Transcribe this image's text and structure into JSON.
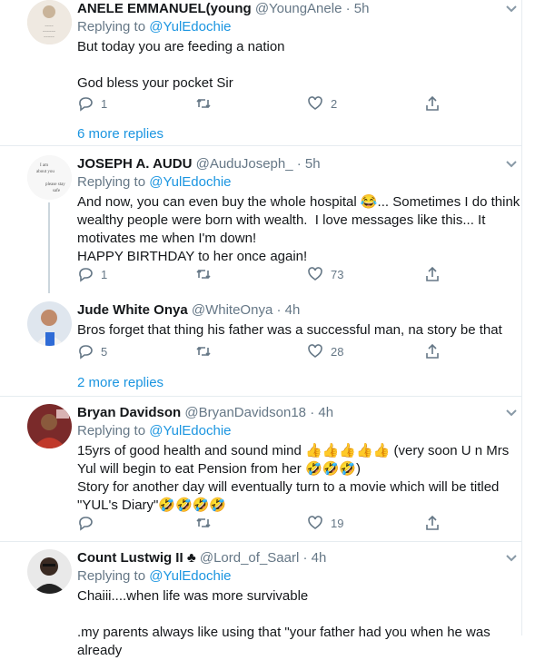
{
  "tweets": [
    {
      "name": "ANELE EMMANUEL(young",
      "handle": "@YoungAnele",
      "time": "· 5h",
      "replying_prefix": "Replying to",
      "replying_to": "@YulEdochie",
      "text": "But today you are feeding a nation\n\nGod bless your pocket Sir",
      "replies": "1",
      "retweets": "",
      "likes": "2",
      "more_replies": "6 more replies"
    },
    {
      "name": "JOSEPH A. AUDU",
      "handle": "@AuduJoseph_",
      "time": "· 5h",
      "replying_prefix": "Replying to",
      "replying_to": "@YulEdochie",
      "text": "And now, you can even buy the whole hospital 😂... Sometimes I do think wealthy people were born with wealth.  I love messages like this... It motivates me when I'm down!\nHAPPY BIRTHDAY to her once again!",
      "replies": "1",
      "retweets": "",
      "likes": "73",
      "more_replies": ""
    },
    {
      "name": "Jude White Onya",
      "handle": "@WhiteOnya",
      "time": "· 4h",
      "replying_prefix": "",
      "replying_to": "",
      "text": "Bros forget that thing his father was a successful man, na story be that",
      "replies": "5",
      "retweets": "",
      "likes": "28",
      "more_replies": "2 more replies"
    },
    {
      "name": "Bryan Davidson",
      "handle": "@BryanDavidson18",
      "time": "· 4h",
      "replying_prefix": "Replying to",
      "replying_to": "@YulEdochie",
      "text": "15yrs of good health and sound mind 👍👍👍👍👍 (very soon U n Mrs Yul will begin to eat Pension from her 🤣🤣🤣)\nStory for another day will eventually turn to a movie which will be titled \"YUL's Diary\"🤣🤣🤣🤣",
      "replies": "",
      "retweets": "",
      "likes": "19",
      "more_replies": ""
    },
    {
      "name": "Count Lustwig II ♣",
      "handle": "@Lord_of_Saarl",
      "time": "· 4h",
      "replying_prefix": "Replying to",
      "replying_to": "@YulEdochie",
      "text": "Chaiii....when life was more survivable\n\n.my parents always like using that \"your father had you when he was already",
      "replies": "",
      "retweets": "",
      "likes": "",
      "more_replies": ""
    }
  ],
  "avatar_captions": {
    "a1": "Shut up and\nhave a\nshirt\nthat\nwill",
    "a2": "I am\nabout you\n\nplease stay\nsafe"
  },
  "colors": {
    "link": "#1b95e0",
    "muted": "#657786",
    "border": "#e6ecf0"
  }
}
